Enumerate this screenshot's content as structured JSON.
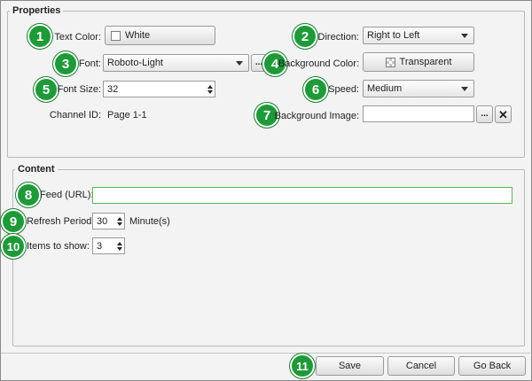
{
  "properties": {
    "legend": "Properties",
    "text_color": {
      "label": "Text Color:",
      "value": "White"
    },
    "font": {
      "label": "Font:",
      "value": "Roboto-Light",
      "more_label": "..."
    },
    "font_size": {
      "label": "Font Size:",
      "value": "32"
    },
    "channel_id": {
      "label": "Channel ID:",
      "value": "Page 1-1"
    },
    "direction": {
      "label": "Direction:",
      "value": "Right to Left"
    },
    "background_color": {
      "label": "Background Color:",
      "value": "Transparent"
    },
    "speed": {
      "label": "Speed:",
      "value": "Medium"
    },
    "background_image": {
      "label": "Background Image:",
      "value": "",
      "more_label": "...",
      "clear_label": "✕"
    }
  },
  "content": {
    "legend": "Content",
    "feed_url": {
      "label": "Feed (URL):",
      "value": ""
    },
    "refresh_period": {
      "label": "Refresh Period:",
      "value": "30",
      "unit": "Minute(s)"
    },
    "items_to_show": {
      "label": "Items to show:",
      "value": "3"
    }
  },
  "footer": {
    "save": "Save",
    "cancel": "Cancel",
    "go_back": "Go Back"
  },
  "callouts": [
    "1",
    "2",
    "3",
    "4",
    "5",
    "6",
    "7",
    "8",
    "9",
    "10",
    "11"
  ],
  "colors": {
    "callout": "#1e9a38",
    "feed_border": "#59b55b"
  }
}
